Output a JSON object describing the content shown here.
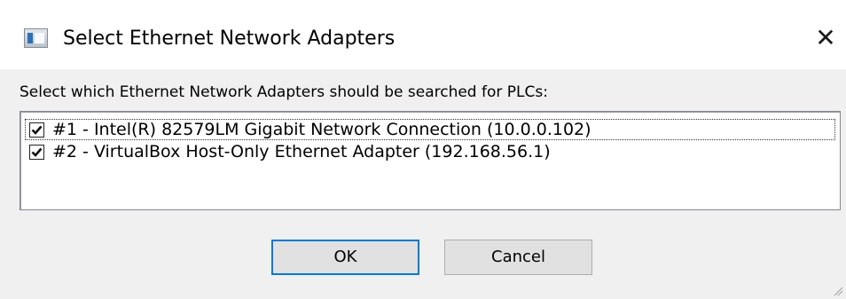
{
  "window": {
    "title": "Select Ethernet Network Adapters",
    "close_glyph": "✕"
  },
  "prompt": "Select which Ethernet Network Adapters should be searched for PLCs:",
  "adapters": [
    {
      "label": "#1 - Intel(R) 82579LM Gigabit Network Connection (10.0.0.102)",
      "checked": true
    },
    {
      "label": "#2 - VirtualBox Host-Only Ethernet Adapter (192.168.56.1)",
      "checked": true
    }
  ],
  "buttons": {
    "ok_label": "OK",
    "cancel_label": "Cancel"
  },
  "icons": {
    "app": "dialog-window-icon",
    "close": "close-icon",
    "check": "checkmark-icon",
    "grip": "resize-grip-icon"
  },
  "colors": {
    "dialog_bg": "#f0f0f0",
    "accent": "#0078d7",
    "button_face": "#e1e1e1"
  }
}
